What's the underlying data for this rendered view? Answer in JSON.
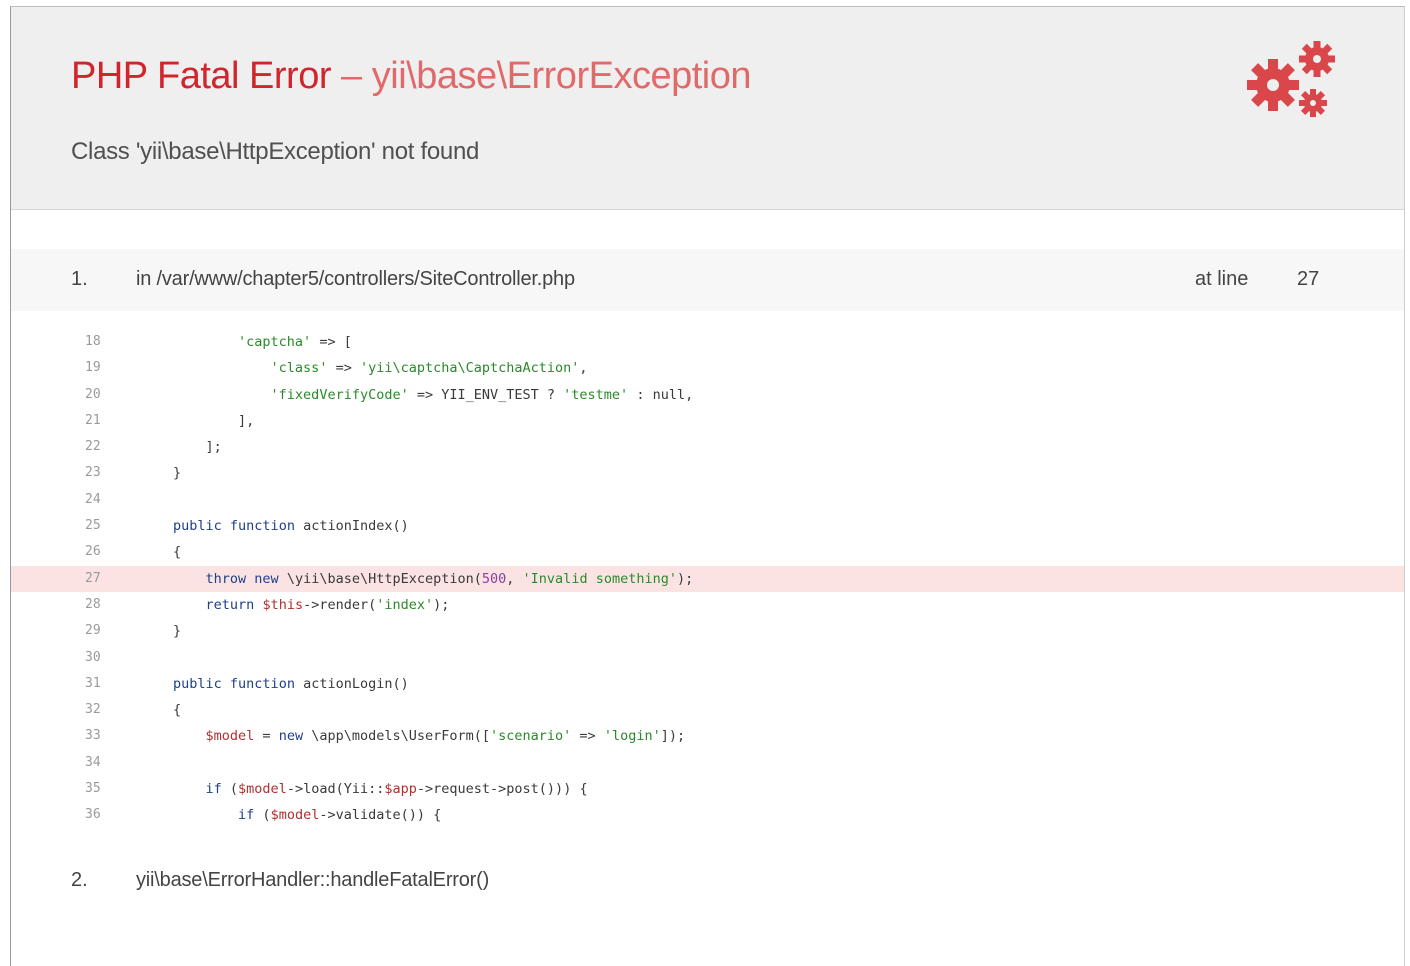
{
  "header": {
    "title": "PHP Fatal Error",
    "separator": "–",
    "exception_class": "yii\\base\\ErrorException",
    "message": "Class 'yii\\base\\HttpException' not found",
    "icon": "gears-icon",
    "accent_color": "#d0252d"
  },
  "call_stack": [
    {
      "number": "1.",
      "file": "in /var/www/chapter5/controllers/SiteController.php",
      "at_line_label": "at line",
      "line": "27"
    },
    {
      "number": "2.",
      "file": "yii\\base\\ErrorHandler::handleFatalError()"
    }
  ],
  "code": {
    "error_line": 27,
    "lines": [
      {
        "no": "18",
        "text": "        'captcha' => ["
      },
      {
        "no": "19",
        "text": "            'class' => 'yii\\captcha\\CaptchaAction',"
      },
      {
        "no": "20",
        "text": "            'fixedVerifyCode' => YII_ENV_TEST ? 'testme' : null,"
      },
      {
        "no": "21",
        "text": "        ],"
      },
      {
        "no": "22",
        "text": "    ];"
      },
      {
        "no": "23",
        "text": "}"
      },
      {
        "no": "24",
        "text": ""
      },
      {
        "no": "25",
        "text": "public function actionIndex()"
      },
      {
        "no": "26",
        "text": "{"
      },
      {
        "no": "27",
        "text": "    throw new \\yii\\base\\HttpException(500, 'Invalid something');"
      },
      {
        "no": "28",
        "text": "    return $this->render('index');"
      },
      {
        "no": "29",
        "text": "}"
      },
      {
        "no": "30",
        "text": ""
      },
      {
        "no": "31",
        "text": "public function actionLogin()"
      },
      {
        "no": "32",
        "text": "{"
      },
      {
        "no": "33",
        "text": "    $model = new \\app\\models\\UserForm(['scenario' => 'login']);"
      },
      {
        "no": "34",
        "text": ""
      },
      {
        "no": "35",
        "text": "    if ($model->load(Yii::$app->request->post())) {"
      },
      {
        "no": "36",
        "text": "        if ($model->validate()) {"
      }
    ]
  }
}
